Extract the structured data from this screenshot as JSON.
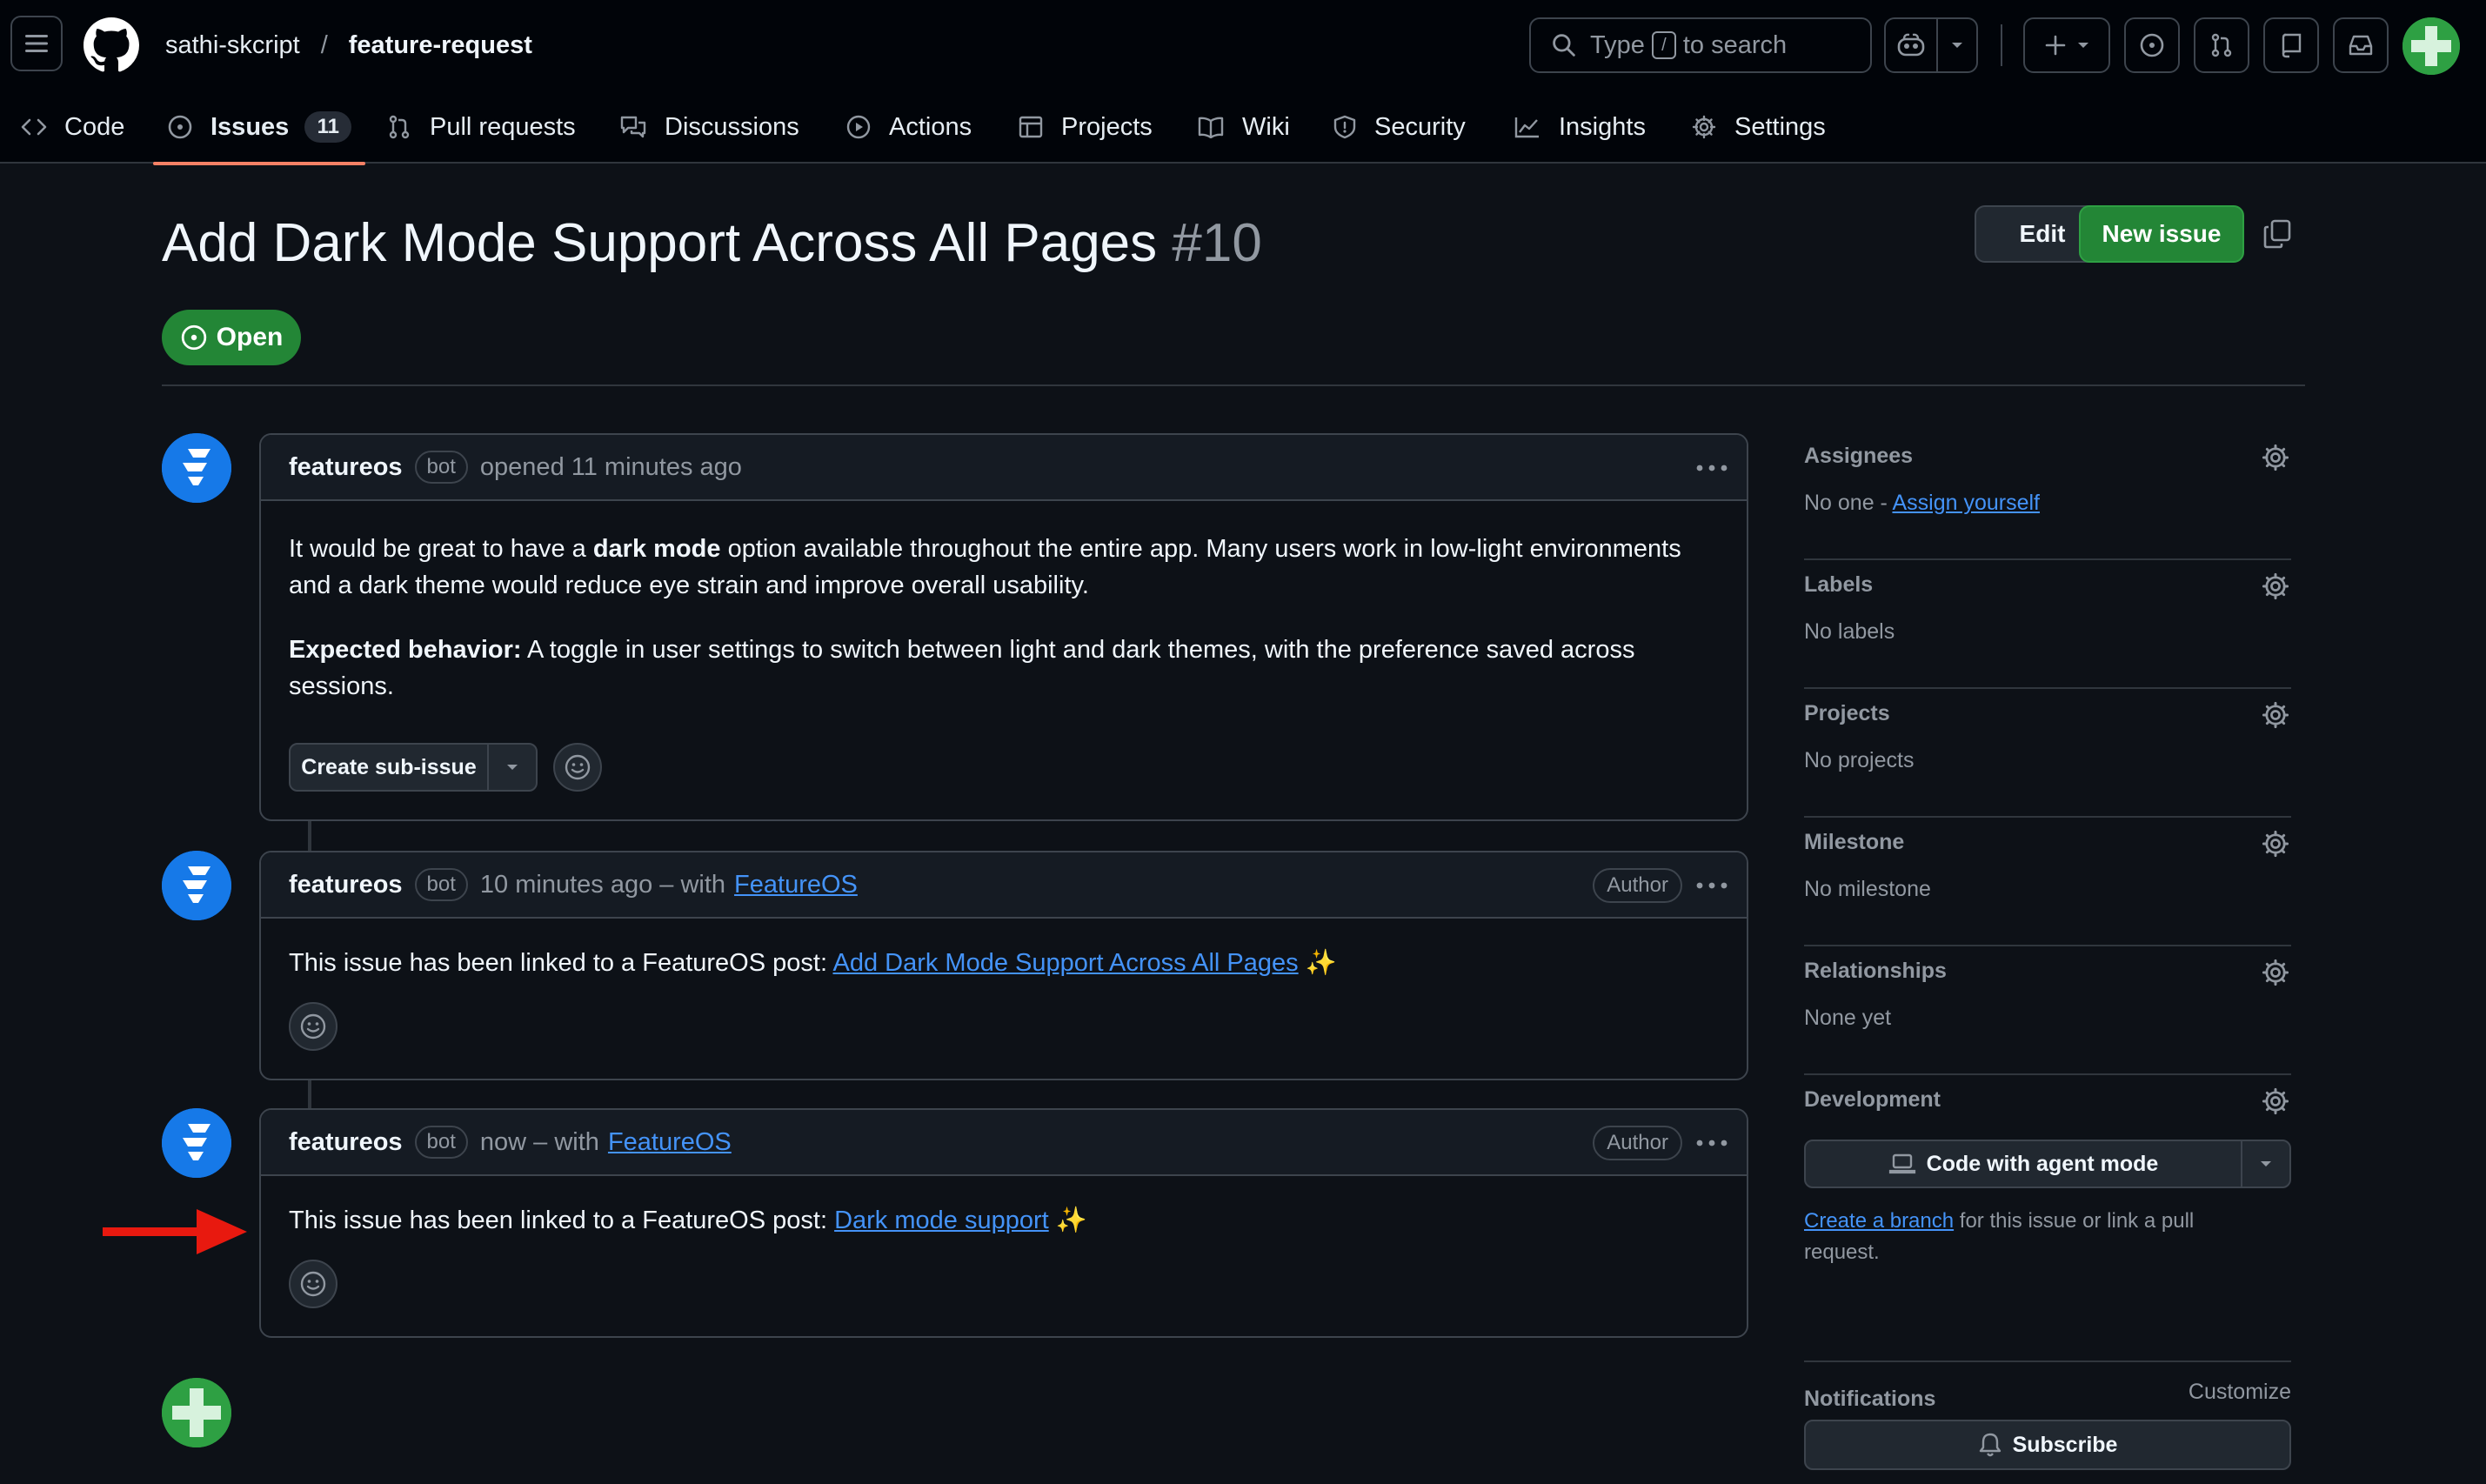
{
  "repo": {
    "owner": "sathi-skcript",
    "separator": "/",
    "name": "feature-request"
  },
  "search": {
    "text_before": "Type",
    "key": "/",
    "text_after": "to search"
  },
  "nav": {
    "tabs": [
      {
        "label": "Code",
        "icon": "code-icon"
      },
      {
        "label": "Issues",
        "icon": "issue-opened-icon",
        "count": "11"
      },
      {
        "label": "Pull requests",
        "icon": "git-pull-request-icon"
      },
      {
        "label": "Discussions",
        "icon": "comment-discussion-icon"
      },
      {
        "label": "Actions",
        "icon": "play-icon"
      },
      {
        "label": "Projects",
        "icon": "table-icon"
      },
      {
        "label": "Wiki",
        "icon": "book-icon"
      },
      {
        "label": "Security",
        "icon": "shield-icon"
      },
      {
        "label": "Insights",
        "icon": "graph-icon"
      },
      {
        "label": "Settings",
        "icon": "gear-icon"
      }
    ]
  },
  "issue": {
    "title": "Add Dark Mode Support Across All Pages",
    "number": "#10",
    "state": "Open",
    "edit_label": "Edit",
    "new_label": "New issue"
  },
  "comments": [
    {
      "user": "featureos",
      "badge": "bot",
      "meta": "opened 11 minutes ago",
      "p1_before": "It would be great to have a ",
      "p1_bold": "dark mode",
      "p1_after": " option available throughout the entire app. Many users work in low-light environments and a dark theme would reduce eye strain and improve overall usability.",
      "p2_bold": "Expected behavior:",
      "p2_after": " A toggle in user settings to switch between light and dark themes, with the preference saved across sessions.",
      "subissue_label": "Create sub-issue"
    },
    {
      "user": "featureos",
      "badge": "bot",
      "meta": "10 minutes ago – with",
      "via": "FeatureOS",
      "author_label": "Author",
      "text": "This issue has been linked to a FeatureOS post:",
      "link": "Add Dark Mode Support Across All Pages",
      "sparkle": "✨"
    },
    {
      "user": "featureos",
      "badge": "bot",
      "meta": "now – with",
      "via": "FeatureOS",
      "author_label": "Author",
      "text": "This issue has been linked to a FeatureOS post:",
      "link": "Dark mode support",
      "sparkle": "✨"
    }
  ],
  "sidebar": {
    "assignees": {
      "title": "Assignees",
      "value": "No one -",
      "action": "Assign yourself"
    },
    "labels": {
      "title": "Labels",
      "value": "No labels"
    },
    "projects": {
      "title": "Projects",
      "value": "No projects"
    },
    "milestone": {
      "title": "Milestone",
      "value": "No milestone"
    },
    "relationships": {
      "title": "Relationships",
      "value": "None yet"
    },
    "development": {
      "title": "Development",
      "agent_label": "Code with agent mode",
      "link": "Create a branch",
      "text": " for this issue or link a pull request."
    },
    "notifications": {
      "title": "Notifications",
      "customize": "Customize",
      "subscribe_label": "Subscribe"
    }
  },
  "colors": {
    "accent_open": "#238636",
    "link": "#4493f8",
    "tab_underline": "#f78166",
    "annotation_arrow": "#e8190f"
  }
}
